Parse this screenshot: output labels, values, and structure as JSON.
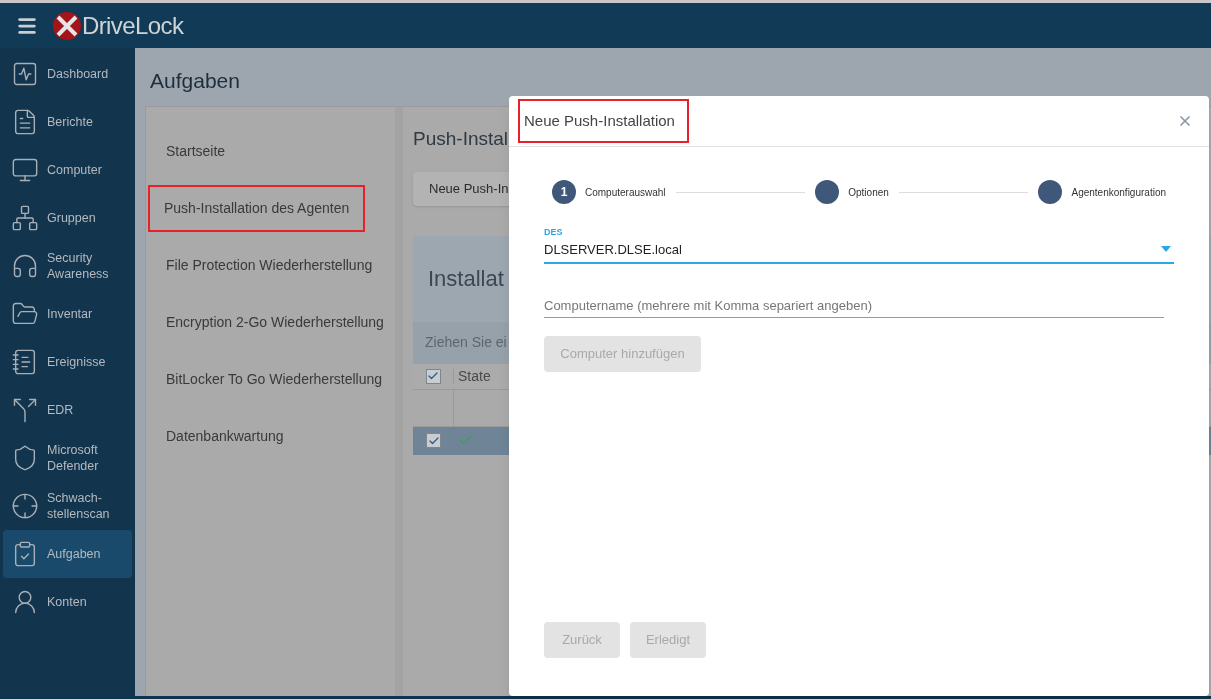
{
  "app": {
    "logo": "Drive**Lock**"
  },
  "sidebar": {
    "items": [
      {
        "label": "Dashboard",
        "selected": false
      },
      {
        "label": "Berichte",
        "selected": false
      },
      {
        "label": "Computer",
        "selected": false
      },
      {
        "label": "Gruppen",
        "selected": false
      },
      {
        "label": "Security\nAwareness",
        "selected": false
      },
      {
        "label": "Inventar",
        "selected": false
      },
      {
        "label": "Ereignisse",
        "selected": false
      },
      {
        "label": "EDR",
        "selected": false
      },
      {
        "label": "Microsoft\nDefender",
        "selected": false
      },
      {
        "label": "Schwach-\nstellenscan",
        "selected": false
      },
      {
        "label": "Aufgaben",
        "selected": true
      },
      {
        "label": "Konten",
        "selected": false
      }
    ]
  },
  "page": {
    "title": "Aufgaben",
    "menu": [
      {
        "label": "Startseite",
        "highlighted": false
      },
      {
        "label": "Push-Installation des Agenten",
        "highlighted": true
      },
      {
        "label": "File Protection Wiederherstellung",
        "highlighted": false
      },
      {
        "label": "Encryption 2-Go Wiederherstellung",
        "highlighted": false
      },
      {
        "label": "BitLocker To Go Wiederherstellung",
        "highlighted": false
      },
      {
        "label": "Datenbankwartung",
        "highlighted": false
      }
    ],
    "content": {
      "title": "Push-Instal",
      "button": "Neue Push-In",
      "card_title": "Installat",
      "group_hint": "Ziehen Sie ei",
      "table": {
        "columns": [
          {
            "label": "State"
          }
        ],
        "header_checked": true,
        "rows": [
          {
            "checked": true,
            "selected": true,
            "state_ok": true
          }
        ]
      }
    }
  },
  "dialog": {
    "title": "Neue Push-Installation",
    "title_highlighted": true,
    "steps": [
      {
        "number": "1",
        "label": "Computerauswahl"
      },
      {
        "label": "Optionen"
      },
      {
        "label": "Agentenkonfiguration"
      }
    ],
    "select": {
      "label": "DES",
      "value": "DLSERVER.DLSE.local"
    },
    "input": {
      "placeholder": "Computername (mehrere mit Komma separiert angeben)"
    },
    "add_button": {
      "label": "Computer hinzufügen",
      "disabled": true
    },
    "footer": [
      {
        "label": "Zurück",
        "disabled": true
      },
      {
        "label": "Erledigt",
        "disabled": true
      }
    ]
  }
}
